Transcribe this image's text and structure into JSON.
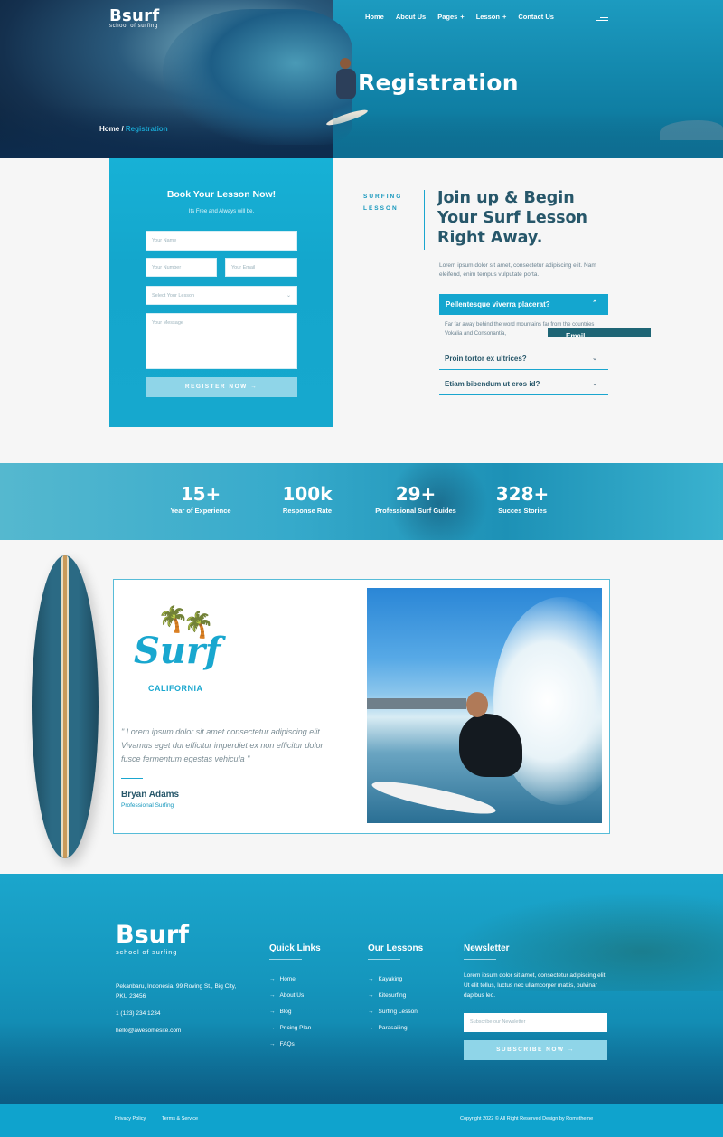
{
  "brand": {
    "name": "Bsurf",
    "tagline": "school of surfing"
  },
  "nav": {
    "items": [
      "Home",
      "About Us",
      "Pages",
      "Lesson",
      "Contact Us"
    ],
    "plus": "+"
  },
  "hero": {
    "title": "Registration",
    "crumb_home": "Home",
    "crumb_sep": " / ",
    "crumb_current": "Registration"
  },
  "booking": {
    "title": "Book Your Lesson Now!",
    "subtitle": "Its Free and Always will be.",
    "name_placeholder": "Your Name",
    "number_placeholder": "Your Number",
    "email_placeholder": "Your Email",
    "lesson_placeholder": "Select Your Lesson",
    "message_placeholder": "Your Message",
    "button": "REGISTER NOW"
  },
  "join": {
    "kicker": "SURFING LESSON",
    "title": "Join up & Begin Your Surf Lesson Right Away.",
    "text": "Lorem ipsum dolor sit amet, consectetur adipiscing elit. Nam eleifend, enim tempus vulputate porta.",
    "accordion": [
      {
        "q": "Pellentesque viverra placerat?",
        "a": "Far far away behind the word mountains far from the countries Vokalia and Consonantia,"
      },
      {
        "q": "Proin tortor ex ultrices?"
      },
      {
        "q": "Etiam bibendum ut eros id?"
      }
    ],
    "overlay_tag": "Email"
  },
  "stats": [
    {
      "value": "15+",
      "label": "Year of Experience"
    },
    {
      "value": "100k",
      "label": "Response Rate"
    },
    {
      "value": "29+",
      "label": "Professional Surf Guides"
    },
    {
      "value": "328+",
      "label": "Succes Stories"
    }
  ],
  "testimonial": {
    "logo_text": "Surf",
    "logo_sub": "CALIFORNIA",
    "quote": "\" Lorem ipsum dolor sit amet consectetur adipiscing elit Vivamus eget dui efficitur imperdiet ex non efficitur dolor fusce fermentum egestas vehicula \"",
    "author": "Bryan Adams",
    "role": "Professional Surfing"
  },
  "footer": {
    "address": "Pekanbaru, Indonesia, 99 Roving St., Big City, PKU 23456",
    "phone": "1 (123) 234 1234",
    "email": "hello@awesomesite.com",
    "quick_title": "Quick Links",
    "quick_links": [
      "Home",
      "About Us",
      "Blog",
      "Pricing Plan",
      "FAQs"
    ],
    "lessons_title": "Our Lessons",
    "lessons": [
      "Kayaking",
      "Kitesurfing",
      "Surfing Lesson",
      "Parasailing"
    ],
    "newsletter_title": "Newsletter",
    "newsletter_text": "Lorem ipsum dolor sit amet, consectetur adipiscing elit. Ut elit tellus, luctus nec ullamcorper mattis, pulvinar dapibus leo.",
    "newsletter_placeholder": "Subscribe our Newsletter",
    "newsletter_button": "SUBSCRIBE NOW",
    "privacy": "Privacy Policy",
    "terms": "Terms & Service",
    "copyright": "Copyright 2022 © All Right Reserved Design by Rometheme"
  },
  "colors": {
    "accent": "#14a6cf",
    "dark_text": "#27576a",
    "button_light": "#8fd5e8"
  }
}
